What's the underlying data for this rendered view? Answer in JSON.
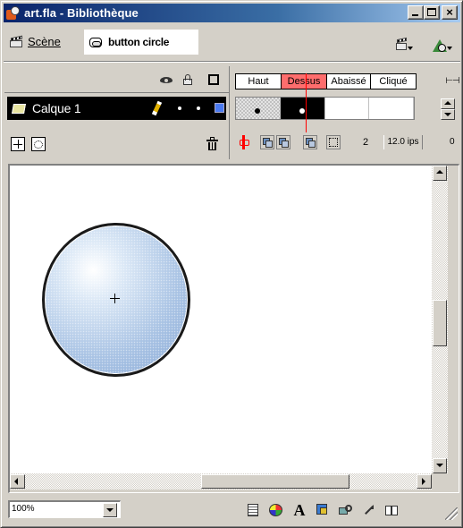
{
  "window": {
    "title": "art.fla - Bibliothèque"
  },
  "edit_bar": {
    "scene_label": "Scène",
    "symbol_label": "button circle"
  },
  "timeline": {
    "layer": {
      "name": "Calque 1",
      "outline_color": "#4a7af0"
    },
    "frame_labels": [
      "Haut",
      "Dessus",
      "Abaissé",
      "Cliqué"
    ],
    "current_frame_label": "Dessus",
    "current_frame_number": "2",
    "frame_rate": "12.0 ips",
    "elapsed_time": "0"
  },
  "stage": {
    "shape": "circle",
    "fill_colors": [
      "#ffffff",
      "#a9c3e4",
      "#8aaad6"
    ],
    "stroke_color": "#1a1a1a"
  },
  "status_bar": {
    "zoom": "100%",
    "panel_icons": [
      "info-icon",
      "swatches-icon",
      "character-icon",
      "instance-icon",
      "movie-explorer-icon",
      "actions-icon",
      "library-icon"
    ],
    "character_glyph": "A"
  }
}
